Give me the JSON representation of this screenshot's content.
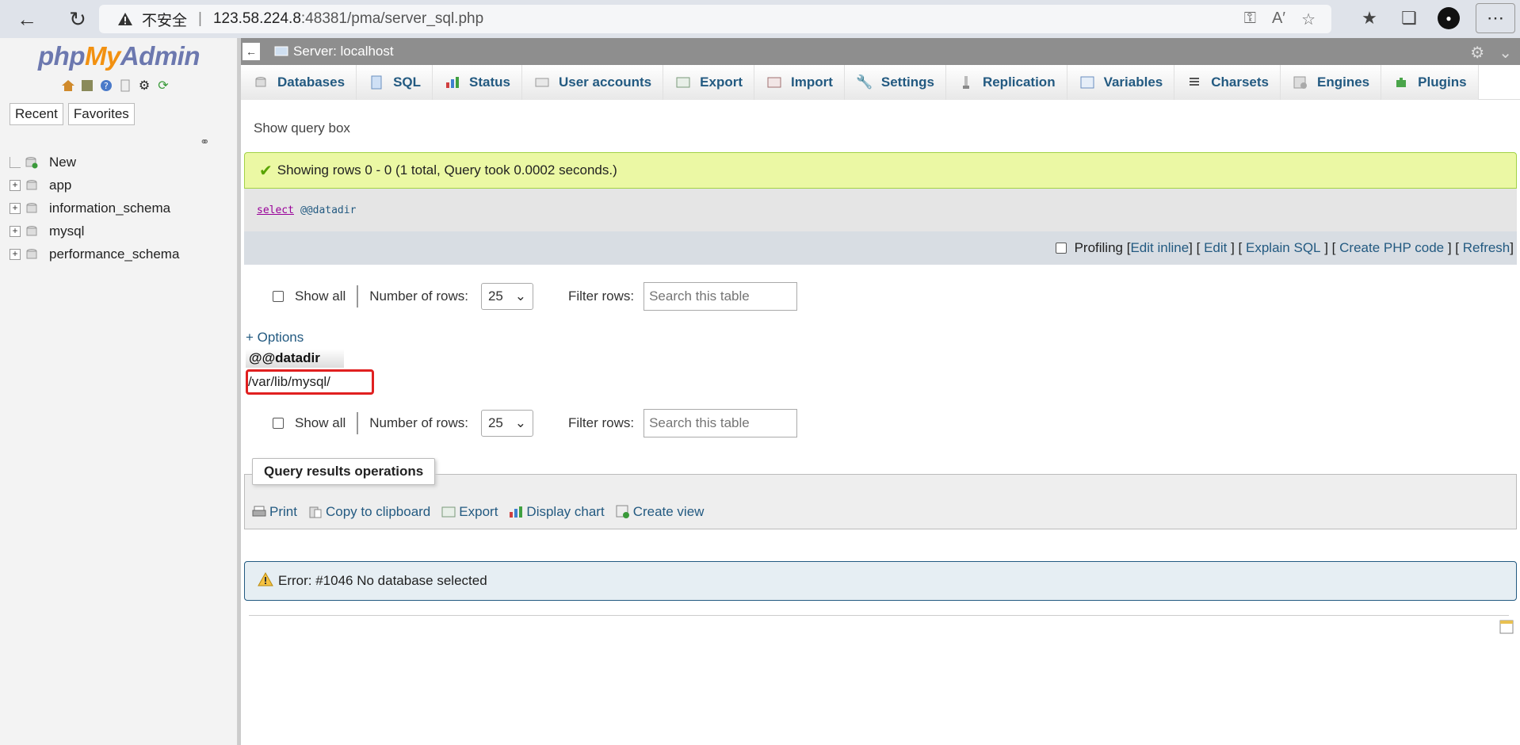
{
  "browser": {
    "insecure_label": "不安全",
    "url_host": "123.58.224.8",
    "url_rest": ":48381/pma/server_sql.php"
  },
  "nav": {
    "logo_php": "php",
    "logo_my": "My",
    "logo_admin": "Admin",
    "recent": "Recent",
    "favorites": "Favorites",
    "tree": [
      "New",
      "app",
      "information_schema",
      "mysql",
      "performance_schema"
    ]
  },
  "server": {
    "title": "Server: localhost"
  },
  "tabs": [
    "Databases",
    "SQL",
    "Status",
    "User accounts",
    "Export",
    "Import",
    "Settings",
    "Replication",
    "Variables",
    "Charsets",
    "Engines",
    "Plugins"
  ],
  "query": {
    "show_query_box": "Show query box",
    "success_msg": "Showing rows 0 - 0 (1 total, Query took 0.0002 seconds.)",
    "sql_keyword": "select",
    "sql_var": "@@datadir",
    "profiling": "Profiling",
    "edit_inline": "Edit inline",
    "edit": "Edit",
    "explain_sql": "Explain SQL",
    "create_php": "Create PHP code",
    "refresh": "Refresh"
  },
  "rows_control": {
    "show_all": "Show all",
    "number_of_rows": "Number of rows:",
    "rows_value": "25",
    "filter_rows": "Filter rows:",
    "search_placeholder": "Search this table"
  },
  "results": {
    "options": "+ Options",
    "column": "@@datadir",
    "value": "/var/lib/mysql/"
  },
  "operations": {
    "legend": "Query results operations",
    "print": "Print",
    "copy": "Copy to clipboard",
    "export": "Export",
    "display_chart": "Display chart",
    "create_view": "Create view"
  },
  "error": {
    "message": "Error: #1046 No database selected"
  },
  "colors": {
    "accent": "#235a81",
    "success_bg": "#ebf8a4",
    "highlight": "#e02020"
  }
}
